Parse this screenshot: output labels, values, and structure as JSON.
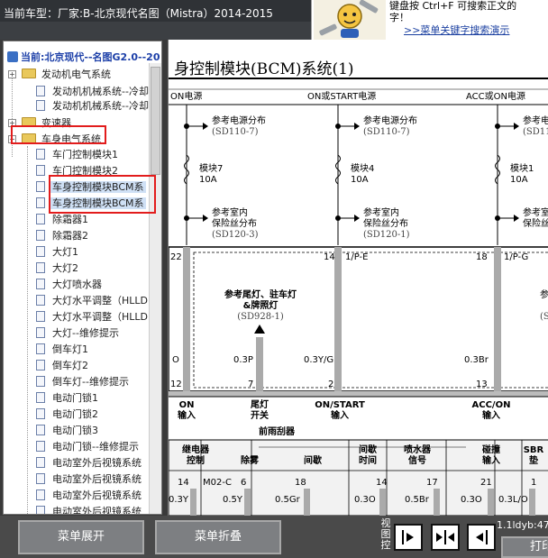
{
  "app": {
    "title": "当前车型：厂家:B-北京现代名图（Mistra）2014-2015",
    "hint_line1": "键盘按 Ctrl+F 可搜索正文的",
    "hint_line2": "字！",
    "search_link": ">>菜单关键字搜索演示"
  },
  "tree": {
    "current": "当前:北京现代--名图G2.0--20",
    "items": [
      {
        "label": "发动机电气系统",
        "type": "folder"
      },
      {
        "label": "发动机机械系统--冷却系",
        "type": "doc"
      },
      {
        "label": "发动机机械系统--冷却系",
        "type": "doc"
      },
      {
        "label": "变速器",
        "type": "folder"
      },
      {
        "label": "车身电气系统",
        "type": "folder"
      },
      {
        "label": "车门控制模块1",
        "type": "doc"
      },
      {
        "label": "车门控制模块2",
        "type": "doc"
      },
      {
        "label": "车身控制模块BCM系",
        "type": "doc"
      },
      {
        "label": "车身控制模块BCM系",
        "type": "doc"
      },
      {
        "label": "除霜器1",
        "type": "doc"
      },
      {
        "label": "除霜器2",
        "type": "doc"
      },
      {
        "label": "大灯1",
        "type": "doc"
      },
      {
        "label": "大灯2",
        "type": "doc"
      },
      {
        "label": "大灯喷水器",
        "type": "doc"
      },
      {
        "label": "大灯水平调整（HLLD",
        "type": "doc"
      },
      {
        "label": "大灯水平调整（HLLD",
        "type": "doc"
      },
      {
        "label": "大灯--维修提示",
        "type": "doc"
      },
      {
        "label": "倒车灯1",
        "type": "doc"
      },
      {
        "label": "倒车灯2",
        "type": "doc"
      },
      {
        "label": "倒车灯--维修提示",
        "type": "doc"
      },
      {
        "label": "电动门锁1",
        "type": "doc"
      },
      {
        "label": "电动门锁2",
        "type": "doc"
      },
      {
        "label": "电动门锁3",
        "type": "doc"
      },
      {
        "label": "电动门锁--维修提示",
        "type": "doc"
      },
      {
        "label": "电动室外后视镜系统",
        "type": "doc"
      },
      {
        "label": "电动室外后视镜系统",
        "type": "doc"
      },
      {
        "label": "电动室外后视镜系统",
        "type": "doc"
      },
      {
        "label": "电动室外后视镜系统",
        "type": "doc"
      }
    ]
  },
  "diagram": {
    "title": "身控制模块(BCM)系统(1)",
    "power_headers": [
      "ON电源",
      "ON或START电源",
      "ACC或ON电源"
    ],
    "ref_power": "参考电源分布",
    "ref_power_code": "(SD110-7)",
    "fuses": [
      {
        "name": "模块7",
        "rating": "10A"
      },
      {
        "name": "模块4",
        "rating": "10A"
      },
      {
        "name": "模块1",
        "rating": "10A"
      }
    ],
    "ref_fusebox_1": "参考室内",
    "ref_fusebox_2": "保险丝分布",
    "ref_fusebox_code": "(SD120-3)",
    "ref_fusebox_code2": "(SD120-1)",
    "connector_top_pins": [
      "22",
      "14",
      "1/P-E",
      "18",
      "1/P-G"
    ],
    "ref_lamp_1": "参考尾灯、驻车灯",
    "ref_lamp_2": "&牌照灯",
    "ref_lamp_code": "(SD928-1)",
    "ref_partial": "参",
    "ref_partial_code": "(S",
    "wire_colors": [
      "O",
      "0.3P",
      "0.3Y/G",
      "0.3Br"
    ],
    "connector_bottom_pins": [
      "12",
      "7",
      "2",
      "13"
    ],
    "inputs": [
      {
        "line1": "ON",
        "line2": "输入"
      },
      {
        "line1": "尾灯",
        "line2": "开关"
      },
      {
        "line1": "ON/START",
        "line2": "输入"
      },
      {
        "line1": "ACC/ON",
        "line2": "输入"
      }
    ],
    "wiper_title": "前雨刮器",
    "lower_labels": [
      {
        "line1": "继电器",
        "line2": "控制"
      },
      {
        "line1": "除雾",
        "line2": ""
      },
      {
        "line1": "间歇",
        "line2": ""
      },
      {
        "line1": "间歇",
        "line2": "时间"
      },
      {
        "line1": "喷水器",
        "line2": "信号"
      },
      {
        "line1": "碰撞",
        "line2": "输入"
      },
      {
        "line1": "SBR",
        "line2": "垫"
      }
    ],
    "lower_pins": [
      "14",
      "M02-C",
      "6",
      "18",
      "14",
      "17",
      "21",
      "1"
    ],
    "lower_wires": [
      "0.3Y",
      "0.5Y",
      "0.5Gr",
      "0.3O",
      "0.5Br",
      "0.3O",
      "0.3L/O"
    ]
  },
  "bottom": {
    "expand_label": "菜单展开",
    "collapse_label": "菜单折叠",
    "view_ctrl": "视图控",
    "status": "1.1ldyb:47",
    "print_label": "打印"
  }
}
